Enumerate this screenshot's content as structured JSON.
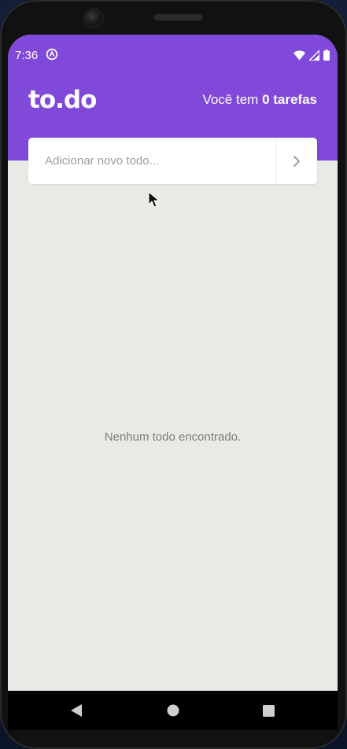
{
  "status_bar": {
    "time": "7:36",
    "icons": [
      "app-notification-icon",
      "wifi-icon",
      "signal-icon",
      "battery-icon"
    ]
  },
  "app": {
    "logo": "to.do",
    "counter_prefix": "Você tem ",
    "counter_value": "0 tarefas"
  },
  "add_todo": {
    "placeholder": "Adicionar novo todo...",
    "value": "",
    "submit_icon": "chevron-right-icon"
  },
  "list": {
    "empty_message": "Nenhum todo encontrado."
  },
  "nav": {
    "buttons": [
      "back-icon",
      "home-icon",
      "recents-icon"
    ]
  },
  "colors": {
    "accent": "#8149d9",
    "background": "#e9e9e6",
    "empty_text": "#7d7d7d"
  }
}
